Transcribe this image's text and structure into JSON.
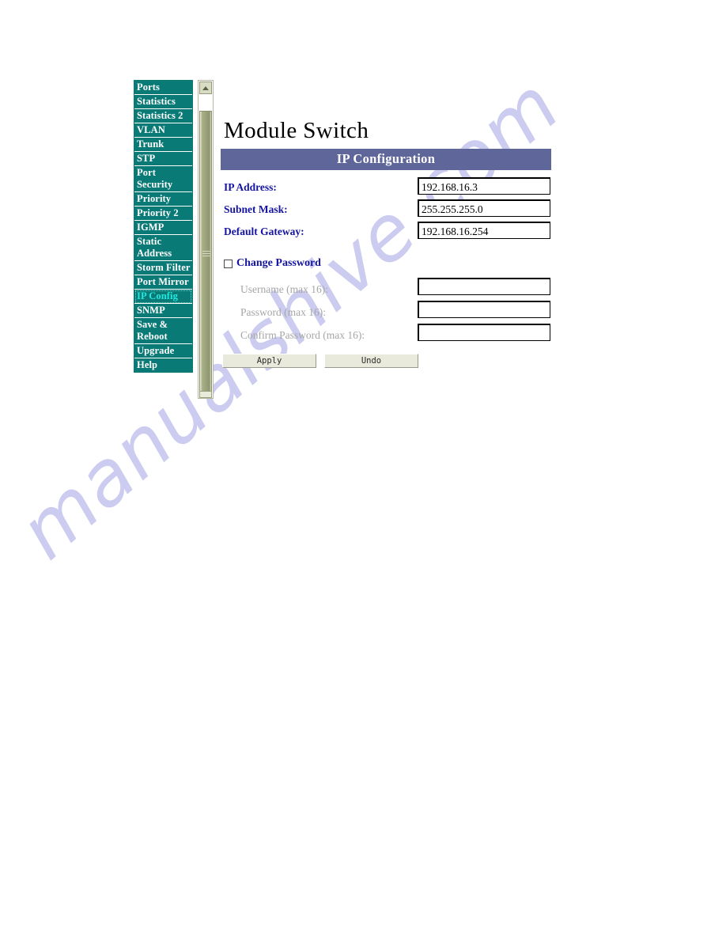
{
  "watermark": {
    "text": "manualshive.com"
  },
  "sidebar": {
    "items": [
      {
        "label": "Ports",
        "name": "sidebar-item-ports",
        "selected": false
      },
      {
        "label": "Statistics",
        "name": "sidebar-item-statistics",
        "selected": false
      },
      {
        "label": "Statistics 2",
        "name": "sidebar-item-statistics-2",
        "selected": false
      },
      {
        "label": "VLAN",
        "name": "sidebar-item-vlan",
        "selected": false
      },
      {
        "label": "Trunk",
        "name": "sidebar-item-trunk",
        "selected": false
      },
      {
        "label": "STP",
        "name": "sidebar-item-stp",
        "selected": false
      },
      {
        "label": "Port Security",
        "name": "sidebar-item-port-security",
        "selected": false
      },
      {
        "label": "Priority",
        "name": "sidebar-item-priority",
        "selected": false
      },
      {
        "label": "Priority 2",
        "name": "sidebar-item-priority-2",
        "selected": false
      },
      {
        "label": "IGMP",
        "name": "sidebar-item-igmp",
        "selected": false
      },
      {
        "label": "Static Address",
        "name": "sidebar-item-static-address",
        "selected": false
      },
      {
        "label": "Storm Filter",
        "name": "sidebar-item-storm-filter",
        "selected": false
      },
      {
        "label": "Port Mirror",
        "name": "sidebar-item-port-mirror",
        "selected": false
      },
      {
        "label": "IP Config",
        "name": "sidebar-item-ip-config",
        "selected": true
      },
      {
        "label": "SNMP",
        "name": "sidebar-item-snmp",
        "selected": false
      },
      {
        "label": "Save & Reboot",
        "name": "sidebar-item-save-reboot",
        "selected": false
      },
      {
        "label": "Upgrade",
        "name": "sidebar-item-upgrade",
        "selected": false
      },
      {
        "label": "Help",
        "name": "sidebar-item-help",
        "selected": false
      }
    ],
    "colors": {
      "background": "#0a7a77",
      "text": "#ffffff",
      "selected_text": "#22e8e0"
    }
  },
  "scrollbar": {
    "up_arrow_icon": "chevron-up-icon",
    "thumb_color": "#9aa279"
  },
  "main": {
    "title": "Module Switch",
    "panel_header": "IP Configuration",
    "panel_header_color": "#5f6699",
    "fields": [
      {
        "label": "IP Address:",
        "value": "192.168.16.3"
      },
      {
        "label": "Subnet Mask:",
        "value": "255.255.255.0"
      },
      {
        "label": "Default Gateway:",
        "value": "192.168.16.254"
      }
    ],
    "change_password": {
      "label": "Change Password",
      "checked": false,
      "fields": [
        {
          "label": "Username (max 16):",
          "value": ""
        },
        {
          "label": "Password (max 16):",
          "value": ""
        },
        {
          "label": "Confirm Password (max 16):",
          "value": ""
        }
      ]
    },
    "buttons": {
      "apply": "Apply",
      "undo": "Undo"
    }
  }
}
